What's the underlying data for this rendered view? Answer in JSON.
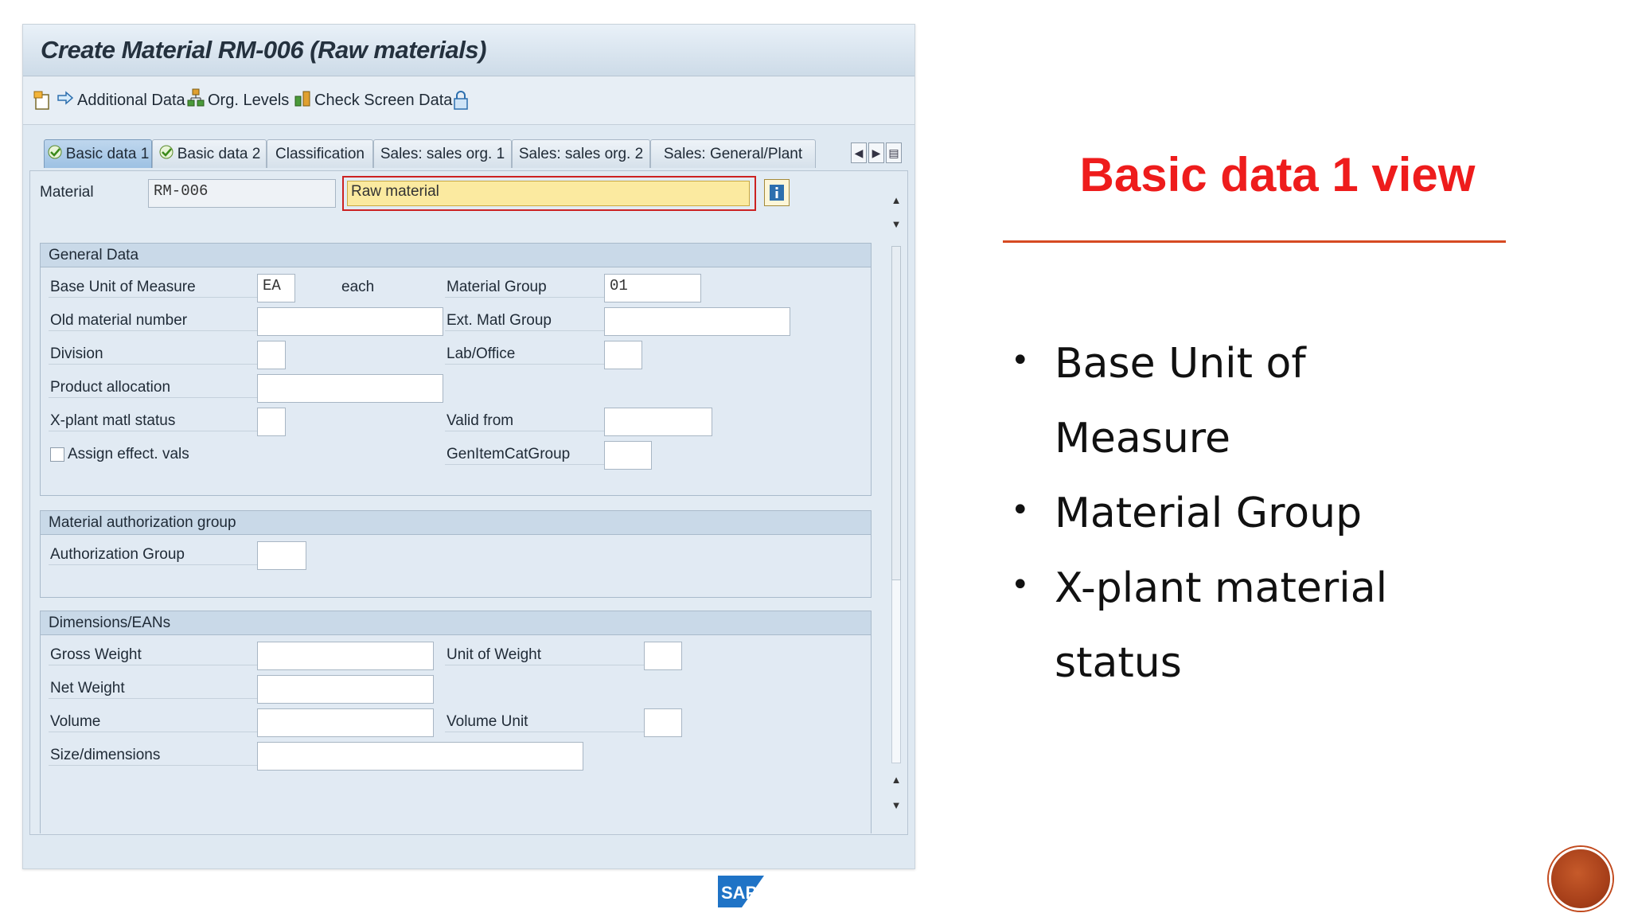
{
  "window": {
    "title": "Create Material RM-006 (Raw materials)"
  },
  "toolbar": {
    "additional_data": "Additional Data",
    "org_levels": "Org. Levels",
    "check_screen_data": "Check Screen Data"
  },
  "tabs": [
    {
      "label": "Basic data 1",
      "active": true,
      "checked": true
    },
    {
      "label": "Basic data 2",
      "checked": true
    },
    {
      "label": "Classification"
    },
    {
      "label": "Sales: sales org. 1"
    },
    {
      "label": "Sales: sales org. 2"
    },
    {
      "label": "Sales: General/Plant"
    }
  ],
  "header": {
    "material_label": "Material",
    "material_value": "RM-006",
    "description_value": "Raw material"
  },
  "general_data": {
    "title": "General Data",
    "base_uom_label": "Base Unit of Measure",
    "base_uom_value": "EA",
    "base_uom_text": "each",
    "material_group_label": "Material Group",
    "material_group_value": "01",
    "old_material_label": "Old material number",
    "ext_matl_group_label": "Ext. Matl Group",
    "division_label": "Division",
    "lab_office_label": "Lab/Office",
    "product_allocation_label": "Product allocation",
    "xplant_status_label": "X-plant matl status",
    "valid_from_label": "Valid from",
    "assign_effect_label": "Assign effect. vals",
    "gen_item_cat_label": "GenItemCatGroup"
  },
  "auth_group": {
    "title": "Material authorization group",
    "authorization_group_label": "Authorization Group"
  },
  "dimensions": {
    "title": "Dimensions/EANs",
    "gross_weight_label": "Gross Weight",
    "unit_of_weight_label": "Unit of Weight",
    "net_weight_label": "Net Weight",
    "volume_label": "Volume",
    "volume_unit_label": "Volume Unit",
    "size_label": "Size/dimensions"
  },
  "slide": {
    "heading": "Basic data 1 view",
    "bullets": [
      {
        "line1": "Base Unit of",
        "line2": "Measure"
      },
      {
        "line1": "Material Group"
      },
      {
        "line1": "X-plant material",
        "line2": "status"
      }
    ]
  },
  "colors": {
    "heading": "#ee1c1c",
    "rule": "#d64a22",
    "circle": "#b54a1f",
    "highlight_field": "#fbeaa0"
  }
}
